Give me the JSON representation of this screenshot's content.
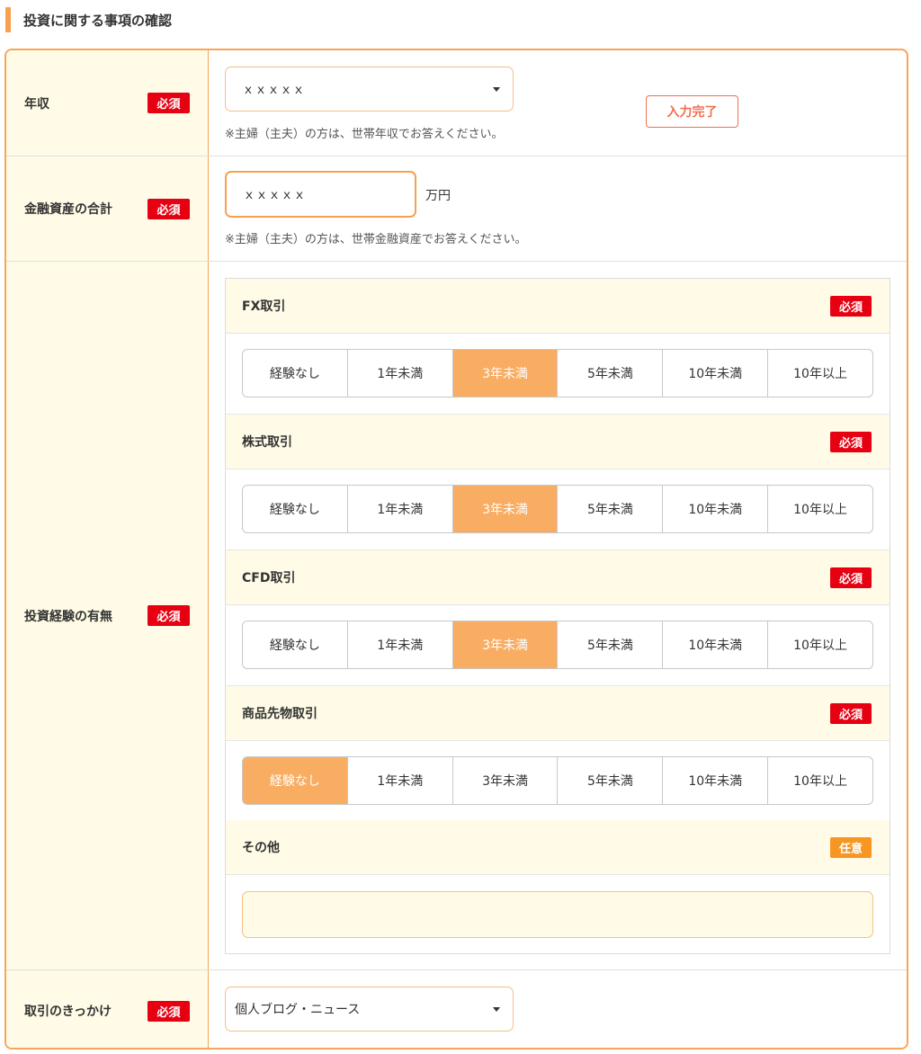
{
  "section": {
    "title": "投資に関する事項の確認"
  },
  "badges": {
    "required": "必須",
    "optional": "任意"
  },
  "income": {
    "label": "年収",
    "select_value": "ｘｘｘｘｘ",
    "note": "※主婦（主夫）の方は、世帯年収でお答えください。",
    "done_button": "入力完了"
  },
  "assets": {
    "label": "金融資産の合計",
    "input_value": "ｘｘｘｘｘ",
    "unit": "万円",
    "note": "※主婦（主夫）の方は、世帯金融資産でお答えください。"
  },
  "experience": {
    "label": "投資経験の有無",
    "options": [
      "経験なし",
      "1年未満",
      "3年未満",
      "5年未満",
      "10年未満",
      "10年以上"
    ],
    "items": [
      {
        "name": "FX取引",
        "badge": "必須",
        "selected": "3年未満"
      },
      {
        "name": "株式取引",
        "badge": "必須",
        "selected": "3年未満"
      },
      {
        "name": "CFD取引",
        "badge": "必須",
        "selected": "3年未満"
      },
      {
        "name": "商品先物取引",
        "badge": "必須",
        "selected": "経験なし"
      }
    ],
    "other": {
      "name": "その他",
      "badge": "任意",
      "value": ""
    }
  },
  "trigger": {
    "label": "取引のきっかけ",
    "select_value": "個人ブログ・ニュース"
  },
  "colors": {
    "accent": "#f7a14f",
    "selected": "#f9ad62",
    "required": "#e60012",
    "optional": "#f79622",
    "label_bg": "#fffbe6"
  }
}
